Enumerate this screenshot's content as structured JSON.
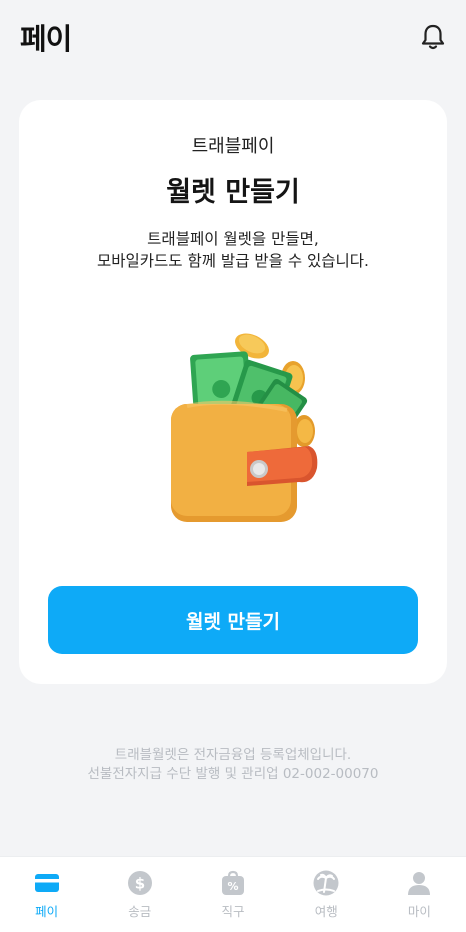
{
  "header": {
    "title": "페이",
    "bell_icon": "bell-icon"
  },
  "card": {
    "subtitle": "트래블페이",
    "heading": "월렛 만들기",
    "description_line1": "트래블페이 월렛을 만들면,",
    "description_line2": "모바일카드도 함께 발급 받을 수 있습니다.",
    "illustration_icon": "wallet-with-money-icon",
    "cta_label": "월렛 만들기"
  },
  "notice": {
    "line1": "트래블월렛은 전자금융업 등록업체입니다.",
    "line2": "선불전자지급 수단 발행 및 관리업 02-002-00070"
  },
  "tabbar": {
    "tabs": [
      {
        "label": "페이",
        "icon": "card-icon",
        "active": true
      },
      {
        "label": "송금",
        "icon": "dollar-coin-icon",
        "active": false
      },
      {
        "label": "직구",
        "icon": "shopping-bag-percent-icon",
        "active": false
      },
      {
        "label": "여행",
        "icon": "palm-tree-icon",
        "active": false
      },
      {
        "label": "마이",
        "icon": "person-icon",
        "active": false
      }
    ]
  },
  "colors": {
    "accent": "#0eaaf7",
    "background": "#f3f4f6",
    "inactive": "#b8bcc2"
  }
}
